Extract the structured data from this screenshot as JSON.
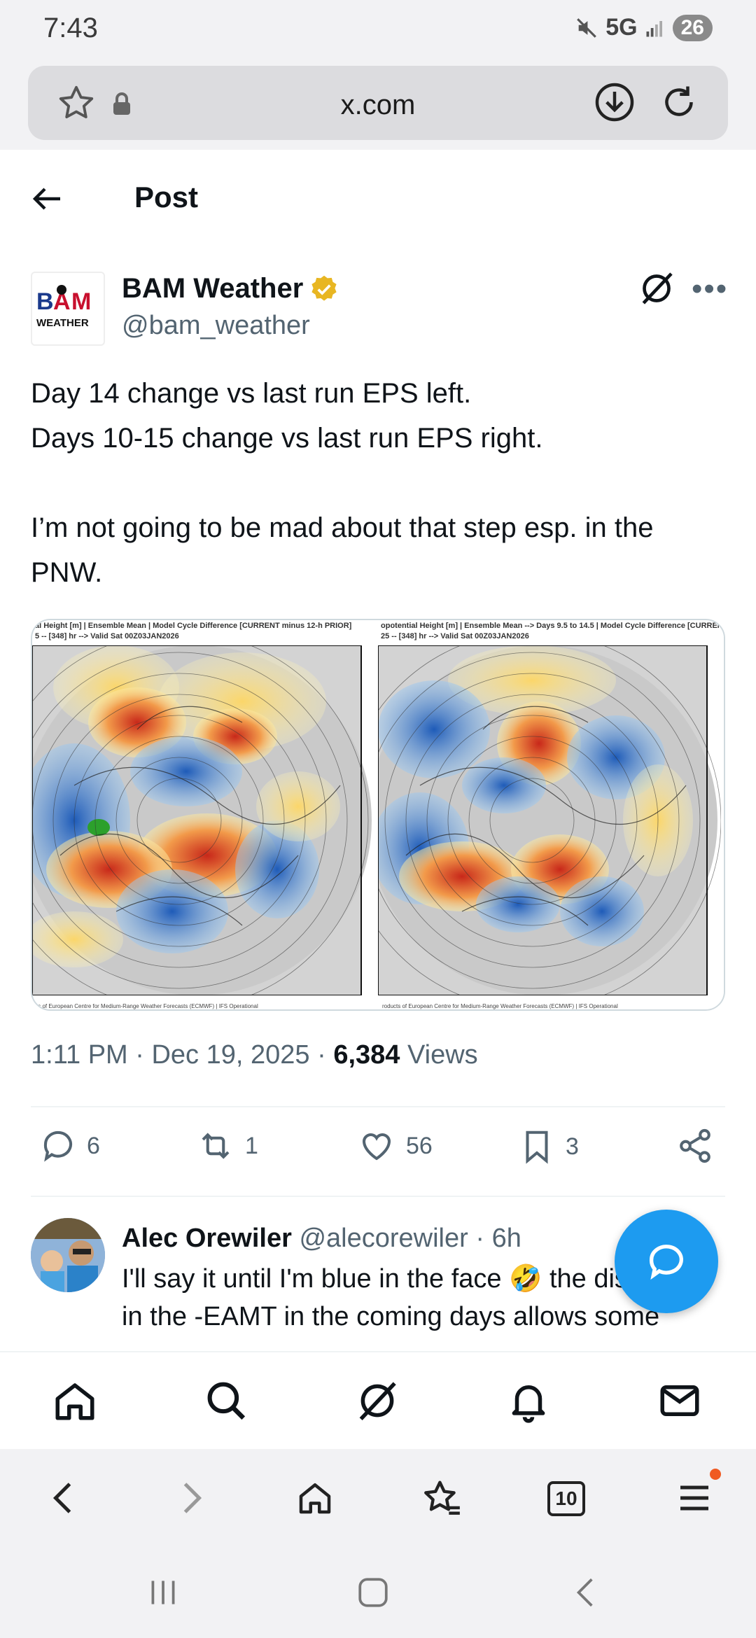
{
  "status_bar": {
    "time": "7:43",
    "network": "5G",
    "battery": "26"
  },
  "browser": {
    "url": "x.com"
  },
  "header": {
    "title": "Post"
  },
  "post": {
    "author_name": "BAM Weather",
    "author_handle": "@bam_weather",
    "avatar_logo_text": "BAM WEATHER",
    "text_lines": [
      "Day 14 change vs last run EPS left.",
      "Days 10-15 change vs last run EPS right.",
      "I’m not going to be mad about that step esp. in the PNW."
    ],
    "images": [
      {
        "caption_line1": "al Height [m] | Ensemble Mean | Model Cycle Difference [CURRENT minus 12-h PRIOR]",
        "caption_line2": "5 -- [348] hr --> Valid Sat 00Z03JAN2026",
        "footer": "ts of European Centre for Medium-Range Weather Forecasts (ECMWF) | IFS Operational"
      },
      {
        "caption_line1": "opotential Height [m] | Ensemble Mean --> Days 9.5 to 14.5 | Model Cycle Difference [CURRENT",
        "caption_line2": "25 -- [348] hr --> Valid Sat 00Z03JAN2026",
        "footer": "roducts of European Centre for Medium-Range Weather Forecasts (ECMWF) | IFS Operational"
      }
    ],
    "time": "1:11 PM",
    "date": "Dec 19, 2025",
    "views_count": "6,384",
    "views_label": "Views",
    "replies": "6",
    "reposts": "1",
    "likes": "56",
    "bookmarks": "3"
  },
  "reply": {
    "name": "Alec Orewiler",
    "handle": "@alecorewiler",
    "age": "· 6h",
    "text": "I'll say it until I'm blue in the face 🤣 the disruption in the -EAMT in the coming days allows some blows to the wpo and epo. I"
  },
  "browser_nav": {
    "tabs_count": "10"
  },
  "colors": {
    "accent": "#1d9bf0",
    "verified": "#e8b622",
    "secondary_text": "#536471"
  }
}
